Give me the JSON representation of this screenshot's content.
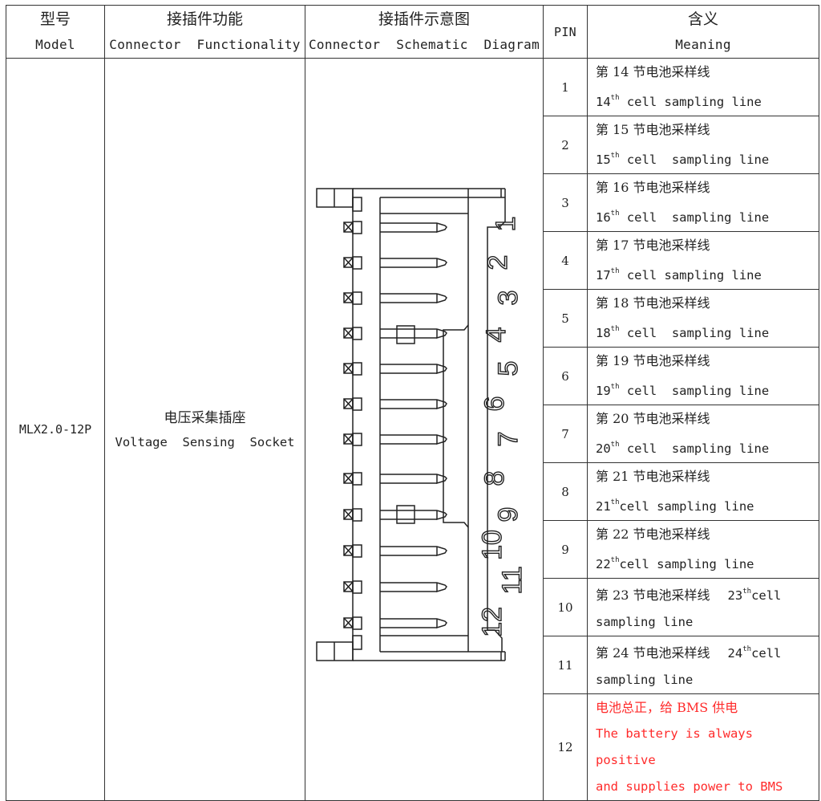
{
  "header": {
    "model_zh": "型号",
    "model_en": "Model",
    "function_zh": "接插件功能",
    "function_en": "Connector  Functionality",
    "diagram_zh": "接插件示意图",
    "diagram_en": "Connector  Schematic  Diagram",
    "pin": "PIN",
    "meaning_zh": "含义",
    "meaning_en": "Meaning"
  },
  "row": {
    "model": "MLX2.0-12P",
    "function_zh": "电压采集插座",
    "function_en": "Voltage  Sensing  Socket"
  },
  "diagram": {
    "pin_labels": [
      "1",
      "2",
      "3",
      "4",
      "5",
      "6",
      "7",
      "8",
      "9",
      "10",
      "11",
      "12"
    ]
  },
  "pins": [
    {
      "pin": "1",
      "zh": "第 14 节电池采样线",
      "num": "14",
      "sup": "th",
      "en": " cell sampling line"
    },
    {
      "pin": "2",
      "zh": "第 15 节电池采样线",
      "num": "15",
      "sup": "th",
      "en": " cell  sampling line"
    },
    {
      "pin": "3",
      "zh": "第 16 节电池采样线",
      "num": "16",
      "sup": "th",
      "en": " cell  sampling line"
    },
    {
      "pin": "4",
      "zh": "第 17 节电池采样线",
      "num": "17",
      "sup": "th",
      "en": " cell sampling line"
    },
    {
      "pin": "5",
      "zh": "第 18 节电池采样线",
      "num": "18",
      "sup": "th",
      "en": " cell  sampling line"
    },
    {
      "pin": "6",
      "zh": "第 19 节电池采样线",
      "num": "19",
      "sup": "th",
      "en": " cell  sampling line"
    },
    {
      "pin": "7",
      "zh": "第 20 节电池采样线",
      "num": "20",
      "sup": "th",
      "en": " cell  sampling line"
    },
    {
      "pin": "8",
      "zh": "第 21 节电池采样线",
      "num": "21",
      "sup": "th",
      "en": "cell sampling line"
    },
    {
      "pin": "9",
      "zh": "第 22 节电池采样线",
      "num": "22",
      "sup": "th",
      "en": "cell sampling line"
    },
    {
      "pin": "10",
      "zh": "第 23 节电池采样线",
      "num": "23",
      "sup": "th",
      "en": "cell",
      "en2": "sampling line"
    },
    {
      "pin": "11",
      "zh": "第 24 节电池采样线",
      "num": "24",
      "sup": "th",
      "en": "cell",
      "en2": "sampling line"
    },
    {
      "pin": "12",
      "zh": "电池总正，给 BMS 供电",
      "en_line1": "The battery is always positive",
      "en_line2": "and supplies power to BMS",
      "color": "#ff2a2a"
    }
  ]
}
